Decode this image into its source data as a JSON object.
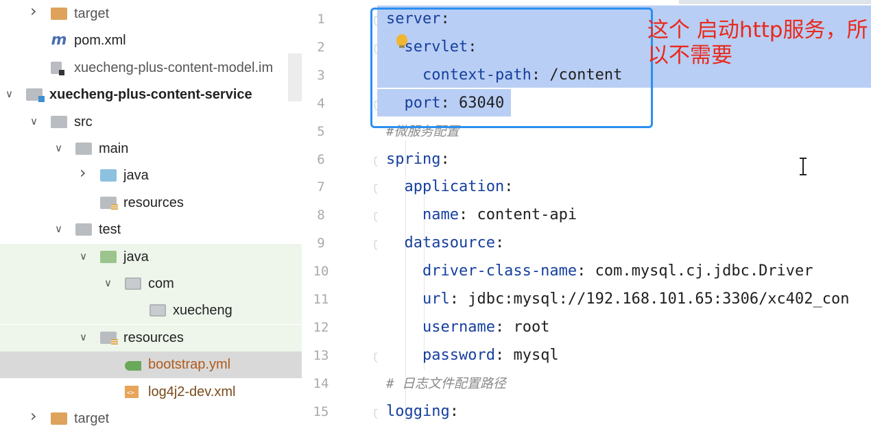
{
  "project_tree": [
    {
      "label": "target",
      "icon": "folder-orange-icon",
      "expanded": false,
      "indent": 1,
      "style": "grey"
    },
    {
      "label": "pom.xml",
      "icon": "maven-icon",
      "indent": 1,
      "style": "normal"
    },
    {
      "label": "xuecheng-plus-content-model.im",
      "icon": "iml-file-icon",
      "indent": 1,
      "style": "grey"
    },
    {
      "label": "xuecheng-plus-content-service",
      "icon": "module-folder-icon",
      "expanded": true,
      "indent": 0,
      "style": "bold"
    },
    {
      "label": "src",
      "icon": "folder-grey-icon",
      "expanded": true,
      "indent": 1,
      "style": "normal"
    },
    {
      "label": "main",
      "icon": "folder-grey-icon",
      "expanded": true,
      "indent": 2,
      "style": "normal"
    },
    {
      "label": "java",
      "icon": "folder-blue-icon",
      "expanded": false,
      "indent": 3,
      "style": "normal"
    },
    {
      "label": "resources",
      "icon": "resources-folder-icon",
      "indent": 3,
      "style": "normal"
    },
    {
      "label": "test",
      "icon": "folder-grey-icon",
      "expanded": true,
      "indent": 2,
      "style": "normal"
    },
    {
      "label": "java",
      "icon": "folder-green-icon",
      "expanded": true,
      "indent": 3,
      "style": "normal"
    },
    {
      "label": "com",
      "icon": "package-icon",
      "expanded": true,
      "indent": 4,
      "style": "normal"
    },
    {
      "label": "xuecheng",
      "icon": "package-icon",
      "indent": 5,
      "style": "normal"
    },
    {
      "label": "resources",
      "icon": "test-resources-folder-icon",
      "expanded": true,
      "indent": 3,
      "style": "normal"
    },
    {
      "label": "bootstrap.yml",
      "icon": "yaml-file-icon",
      "indent": 4,
      "style": "orange",
      "selected": true
    },
    {
      "label": "log4j2-dev.xml",
      "icon": "xml-file-icon",
      "indent": 4,
      "style": "brown"
    },
    {
      "label": "target",
      "icon": "folder-orange-icon",
      "expanded": false,
      "indent": 1,
      "style": "grey"
    }
  ],
  "editor": {
    "line_numbers": [
      "1",
      "2",
      "3",
      "4",
      "5",
      "6",
      "7",
      "8",
      "9",
      "10",
      "11",
      "12",
      "13",
      "14",
      "15"
    ],
    "lines": [
      {
        "key": "server",
        "sep": ":",
        "value": ""
      },
      {
        "key": "  servlet",
        "sep": ":",
        "value": ""
      },
      {
        "key": "    context-path",
        "sep": ": ",
        "value": "/content"
      },
      {
        "key": "  port",
        "sep": ": ",
        "value": "63040"
      },
      {
        "comment": "#微服务配置"
      },
      {
        "key": "spring",
        "sep": ":",
        "value": ""
      },
      {
        "key": "  application",
        "sep": ":",
        "value": ""
      },
      {
        "key": "    name",
        "sep": ": ",
        "value": "content-api"
      },
      {
        "key": "  datasource",
        "sep": ":",
        "value": ""
      },
      {
        "key": "    driver-class-name",
        "sep": ": ",
        "value": "com.mysql.cj.jdbc.Driver"
      },
      {
        "key": "    url",
        "sep": ": ",
        "value": "jdbc:mysql://192.168.101.65:3306/xc402_con"
      },
      {
        "key": "    username",
        "sep": ": ",
        "value": "root"
      },
      {
        "key": "    password",
        "sep": ": ",
        "value": "mysql"
      },
      {
        "comment": "# 日志文件配置路径"
      },
      {
        "key": "logging",
        "sep": ":",
        "value": ""
      }
    ]
  },
  "annotation": {
    "text": "这个 启动http服务，所以不需要",
    "color": "#e8291c",
    "box_color": "#2b8ff0"
  },
  "colors": {
    "selection": "#b9cef4",
    "yaml_key": "#163f9e",
    "tree_selected_bg": "#d9d9d9",
    "tree_test_bg": "#eef6ec"
  }
}
